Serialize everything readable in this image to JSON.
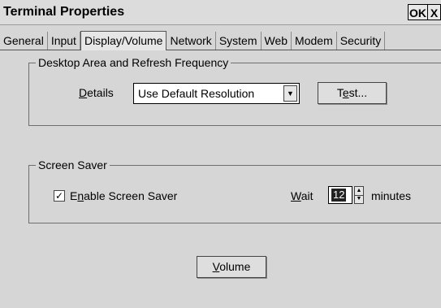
{
  "window": {
    "title": "Terminal Properties",
    "ok_label": "OK",
    "close_label": "X"
  },
  "tabs": [
    {
      "label": "General"
    },
    {
      "label": "Input"
    },
    {
      "label": "Display/Volume",
      "active": true
    },
    {
      "label": "Network"
    },
    {
      "label": "System"
    },
    {
      "label": "Web"
    },
    {
      "label": "Modem"
    },
    {
      "label": "Security"
    }
  ],
  "desktop_area": {
    "group_title": "Desktop Area and Refresh Frequency",
    "details_label_mnemonic": "D",
    "details_label_rest": "etails",
    "details_value": "Use Default Resolution",
    "test_label_pre": "T",
    "test_label_mnemonic": "e",
    "test_label_post": "st..."
  },
  "screen_saver": {
    "group_title": "Screen Saver",
    "enable_checked": true,
    "check_mark": "✓",
    "enable_label_pre": "E",
    "enable_label_mnemonic": "n",
    "enable_label_post": "able Screen Saver",
    "wait_label_mnemonic": "W",
    "wait_label_rest": "ait",
    "wait_value": "12",
    "wait_units": "minutes"
  },
  "volume": {
    "label_mnemonic": "V",
    "label_rest": "olume"
  },
  "icons": {
    "dropdown": "chevron-down-icon",
    "spin_up": "triangle-up-icon",
    "spin_down": "triangle-down-icon"
  }
}
